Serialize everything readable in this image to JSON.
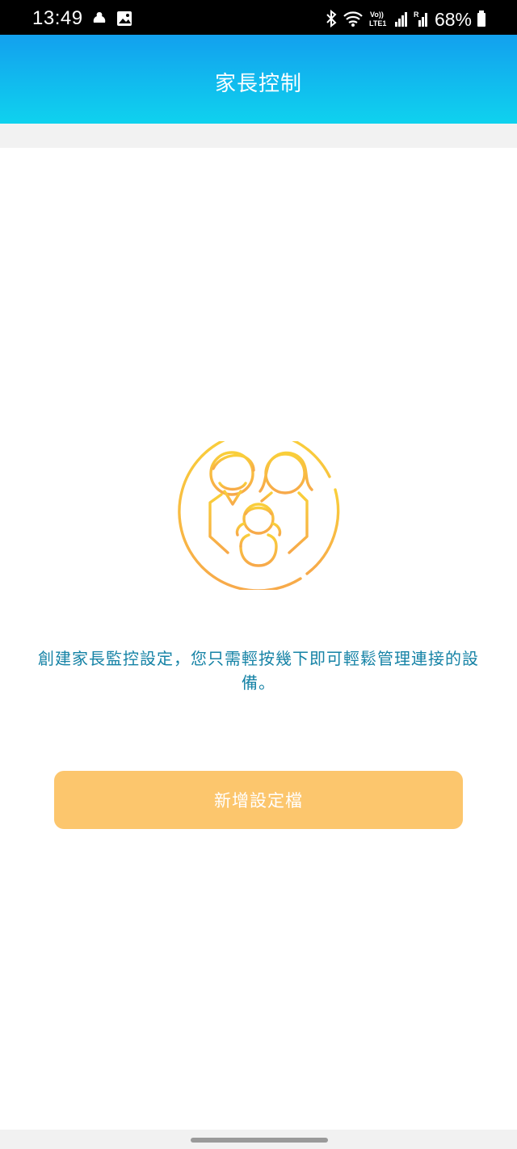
{
  "status_bar": {
    "time": "13:49",
    "battery_percent": "68%",
    "icons_left": [
      "notification-icon",
      "image-icon"
    ],
    "icons_right": [
      "bluetooth-icon",
      "wifi-icon",
      "volte-icon",
      "signal-icon",
      "signal-roaming-icon",
      "battery-icon"
    ]
  },
  "header": {
    "title": "家長控制"
  },
  "main": {
    "illustration_icon": "family-icon",
    "description": "創建家長監控設定，您只需輕按幾下即可輕鬆管理連接的設備。",
    "add_profile_label": "新增設定檔"
  },
  "colors": {
    "header_top": "#13a0ee",
    "header_bottom": "#0fd2ee",
    "accent_orange": "#fcc66d",
    "text_teal": "#1683a6"
  }
}
